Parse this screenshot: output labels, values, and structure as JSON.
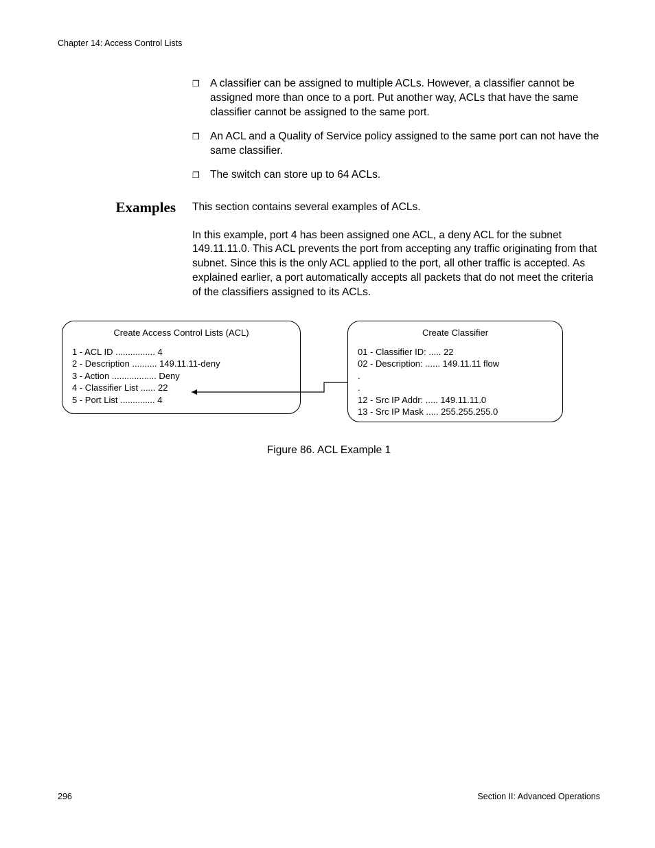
{
  "header": {
    "chapter": "Chapter 14: Access Control Lists"
  },
  "bullets": [
    "A classifier can be assigned to multiple ACLs. However, a classifier cannot be assigned more than once to a port. Put another way, ACLs that have the same classifier cannot be assigned to the same port.",
    "An ACL and a Quality of Service policy assigned to the same port can not have the same classifier.",
    "The switch can store up to 64 ACLs."
  ],
  "examples": {
    "heading": "Examples",
    "intro": "This section contains several examples of ACLs.",
    "paragraph": "In this example, port 4 has been assigned one ACL, a deny ACL for the subnet 149.11.11.0. This ACL prevents the port from accepting any traffic originating from that subnet. Since this is the only ACL applied to the port, all other traffic is accepted. As explained earlier, a port automatically accepts all packets that do not meet the criteria of the classifiers assigned to its ACLs."
  },
  "figure": {
    "left_panel": {
      "title": "Create Access Control Lists (ACL)",
      "lines": [
        "1 - ACL ID ................ 4",
        "2 - Description .......... 149.11.11-deny",
        "3 - Action .................. Deny",
        "4 - Classifier List ...... 22",
        "5 - Port List .............. 4"
      ]
    },
    "right_panel": {
      "title": "Create Classifier",
      "lines": [
        "01 - Classifier ID: ..... 22",
        "02 - Description: ...... 149.11.11 flow",
        ".",
        ".",
        "12 - Src IP Addr: ..... 149.11.11.0",
        "13 - Src IP Mask ..... 255.255.255.0"
      ]
    },
    "caption": "Figure 86. ACL Example 1"
  },
  "footer": {
    "page_number": "296",
    "section": "Section II: Advanced Operations"
  }
}
